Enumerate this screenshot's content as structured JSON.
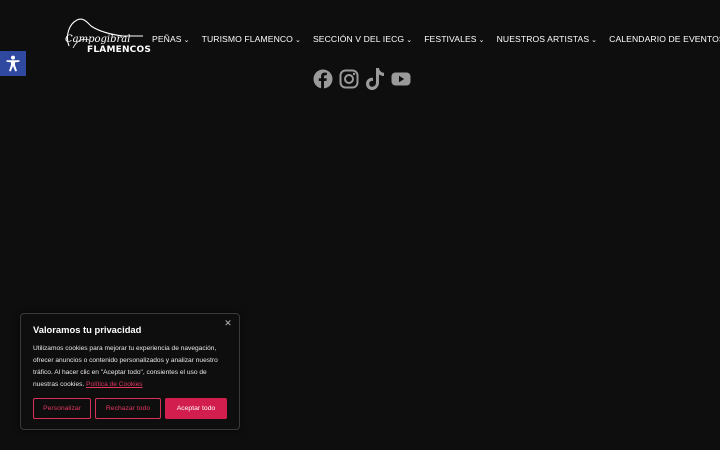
{
  "logo": {
    "script_text": "Campogibral",
    "brand_text": "FLAMENCOS"
  },
  "nav": {
    "items": [
      {
        "label": "PEÑAS",
        "has_dropdown": true
      },
      {
        "label": "TURISMO FLAMENCO",
        "has_dropdown": true
      },
      {
        "label": "SECCIÓN V DEL IECG",
        "has_dropdown": true
      },
      {
        "label": "FESTIVALES",
        "has_dropdown": true
      },
      {
        "label": "NUESTROS ARTISTAS",
        "has_dropdown": true
      },
      {
        "label": "CALENDARIO DE EVENTOS",
        "has_dropdown": false
      }
    ],
    "chevron": "⌄"
  },
  "social": {
    "icons": [
      "facebook-icon",
      "instagram-icon",
      "tiktok-icon",
      "youtube-icon"
    ]
  },
  "accessibility": {
    "icon": "accessibility-icon",
    "color": "#2f48a0"
  },
  "cookie_banner": {
    "title": "Valoramos tu privacidad",
    "text": "Utilizamos cookies para mejorar tu experiencia de navegación, ofrecer anuncios o contenido personalizados y analizar nuestro tráfico. Al hacer clic en \"Aceptar todo\", consientes el uso de nuestras cookies.",
    "link_text": "Política de Cookies",
    "close_label": "✕",
    "buttons": {
      "customize": "Personalizar",
      "reject": "Rechazar todo",
      "accept": "Aceptar todo"
    },
    "accent_color": "#d21e4e"
  },
  "colors": {
    "background": "#0e0e0f",
    "text": "#ffffff",
    "icon_gray": "#9a9a9a"
  }
}
